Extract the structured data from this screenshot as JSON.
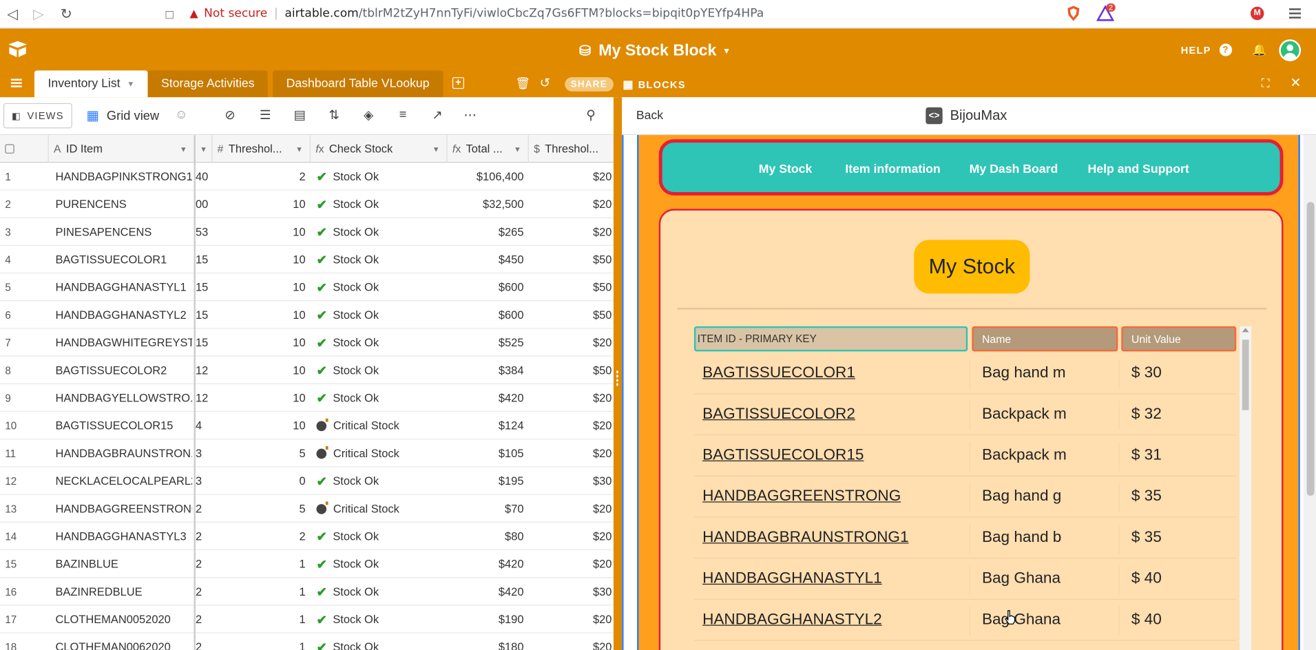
{
  "browser": {
    "security_label": "Not secure",
    "url_domain": "airtable.com",
    "url_path": "/tblrM2tZyH7nnTyFi/viwloCbcZq7Gs6FTM?blocks=bipqit0pYEYfp4HPa",
    "brave_badge": "2"
  },
  "header": {
    "base_title": "My Stock Block",
    "help_label": "HELP",
    "share_label": "SHARE",
    "blocks_label": "BLOCKS",
    "tabs": [
      {
        "label": "Inventory List"
      },
      {
        "label": "Storage Activities"
      },
      {
        "label": "Dashboard Table VLookup"
      }
    ]
  },
  "toolbar": {
    "views_label": "VIEWS",
    "view_name": "Grid view"
  },
  "grid": {
    "columns": [
      {
        "label": "ID Item"
      },
      {
        "label": "Threshol..."
      },
      {
        "label": "Check Stock"
      },
      {
        "label": "Total ..."
      },
      {
        "label": "Threshol..."
      }
    ],
    "rows": [
      {
        "n": "1",
        "id": "HANDBAGPINKSTRONG1",
        "q": "40",
        "t": "2",
        "status": "Stock Ok",
        "ok": true,
        "total": "$106,400",
        "th": "$20"
      },
      {
        "n": "2",
        "id": "PURENCENS",
        "q": "00",
        "t": "10",
        "status": "Stock Ok",
        "ok": true,
        "total": "$32,500",
        "th": "$20"
      },
      {
        "n": "3",
        "id": "PINESAPENCENS",
        "q": "53",
        "t": "10",
        "status": "Stock Ok",
        "ok": true,
        "total": "$265",
        "th": "$20"
      },
      {
        "n": "4",
        "id": "BAGTISSUECOLOR1",
        "q": "15",
        "t": "10",
        "status": "Stock Ok",
        "ok": true,
        "total": "$450",
        "th": "$50"
      },
      {
        "n": "5",
        "id": "HANDBAGGHANASTYL1",
        "q": "15",
        "t": "10",
        "status": "Stock Ok",
        "ok": true,
        "total": "$600",
        "th": "$50"
      },
      {
        "n": "6",
        "id": "HANDBAGGHANASTYL2",
        "q": "15",
        "t": "10",
        "status": "Stock Ok",
        "ok": true,
        "total": "$600",
        "th": "$50"
      },
      {
        "n": "7",
        "id": "HANDBAGWHITEGREYST...",
        "q": "15",
        "t": "10",
        "status": "Stock Ok",
        "ok": true,
        "total": "$525",
        "th": "$20"
      },
      {
        "n": "8",
        "id": "BAGTISSUECOLOR2",
        "q": "12",
        "t": "10",
        "status": "Stock Ok",
        "ok": true,
        "total": "$384",
        "th": "$50"
      },
      {
        "n": "9",
        "id": "HANDBAGYELLOWSTRO...",
        "q": "12",
        "t": "10",
        "status": "Stock Ok",
        "ok": true,
        "total": "$420",
        "th": "$20"
      },
      {
        "n": "10",
        "id": "BAGTISSUECOLOR15",
        "q": "4",
        "t": "10",
        "status": "Critical Stock",
        "ok": false,
        "total": "$124",
        "th": "$20"
      },
      {
        "n": "11",
        "id": "HANDBAGBRAUNSTRON...",
        "q": "3",
        "t": "5",
        "status": "Critical Stock",
        "ok": false,
        "total": "$105",
        "th": "$20"
      },
      {
        "n": "12",
        "id": "NECKLACELOCALPEARL2",
        "q": "3",
        "t": "0",
        "status": "Stock Ok",
        "ok": true,
        "total": "$195",
        "th": "$30"
      },
      {
        "n": "13",
        "id": "HANDBAGGREENSTRONG",
        "q": "2",
        "t": "5",
        "status": "Critical Stock",
        "ok": false,
        "total": "$70",
        "th": "$20"
      },
      {
        "n": "14",
        "id": "HANDBAGGHANASTYL3",
        "q": "2",
        "t": "2",
        "status": "Stock Ok",
        "ok": true,
        "total": "$80",
        "th": "$20"
      },
      {
        "n": "15",
        "id": "BAZINBLUE",
        "q": "2",
        "t": "1",
        "status": "Stock Ok",
        "ok": true,
        "total": "$420",
        "th": "$20"
      },
      {
        "n": "16",
        "id": "BAZINREDBLUE",
        "q": "2",
        "t": "1",
        "status": "Stock Ok",
        "ok": true,
        "total": "$420",
        "th": "$30"
      },
      {
        "n": "17",
        "id": "CLOTHEMAN0052020",
        "q": "2",
        "t": "1",
        "status": "Stock Ok",
        "ok": true,
        "total": "$190",
        "th": "$20"
      },
      {
        "n": "18",
        "id": "CLOTHEMAN0062020",
        "q": "2",
        "t": "1",
        "status": "Stock Ok",
        "ok": true,
        "total": "$180",
        "th": "$20"
      }
    ]
  },
  "block": {
    "back_label": "Back",
    "name": "BijouMax",
    "nav": [
      "My Stock",
      "Item information",
      "My Dash Board",
      "Help and Support"
    ],
    "page_title": "My Stock",
    "table_headers": [
      "ITEM ID - PRIMARY KEY",
      "Name",
      "Unit Value"
    ],
    "items": [
      {
        "id": "BAGTISSUECOLOR1",
        "name": "Bag hand m",
        "value": "$ 30"
      },
      {
        "id": "BAGTISSUECOLOR2",
        "name": "Backpack m",
        "value": "$ 32"
      },
      {
        "id": "BAGTISSUECOLOR15",
        "name": "Backpack m",
        "value": "$ 31"
      },
      {
        "id": "HANDBAGGREENSTRONG",
        "name": "Bag hand g",
        "value": "$ 35"
      },
      {
        "id": "HANDBAGBRAUNSTRONG1",
        "name": "Bag hand b",
        "value": "$ 35"
      },
      {
        "id": "HANDBAGGHANASTYL1",
        "name": "Bag Ghana",
        "value": "$ 40"
      },
      {
        "id": "HANDBAGGHANASTYL2",
        "name": "Bag Ghana",
        "value": "$ 40"
      }
    ]
  },
  "colors": {
    "airtable_orange": "#e08a00",
    "app_orange": "#ff9f1c",
    "nav_teal": "#2ec4b6",
    "accent_red": "#e71d36",
    "card_bg": "#ffdeb0",
    "title_yellow": "#ffbc00"
  }
}
